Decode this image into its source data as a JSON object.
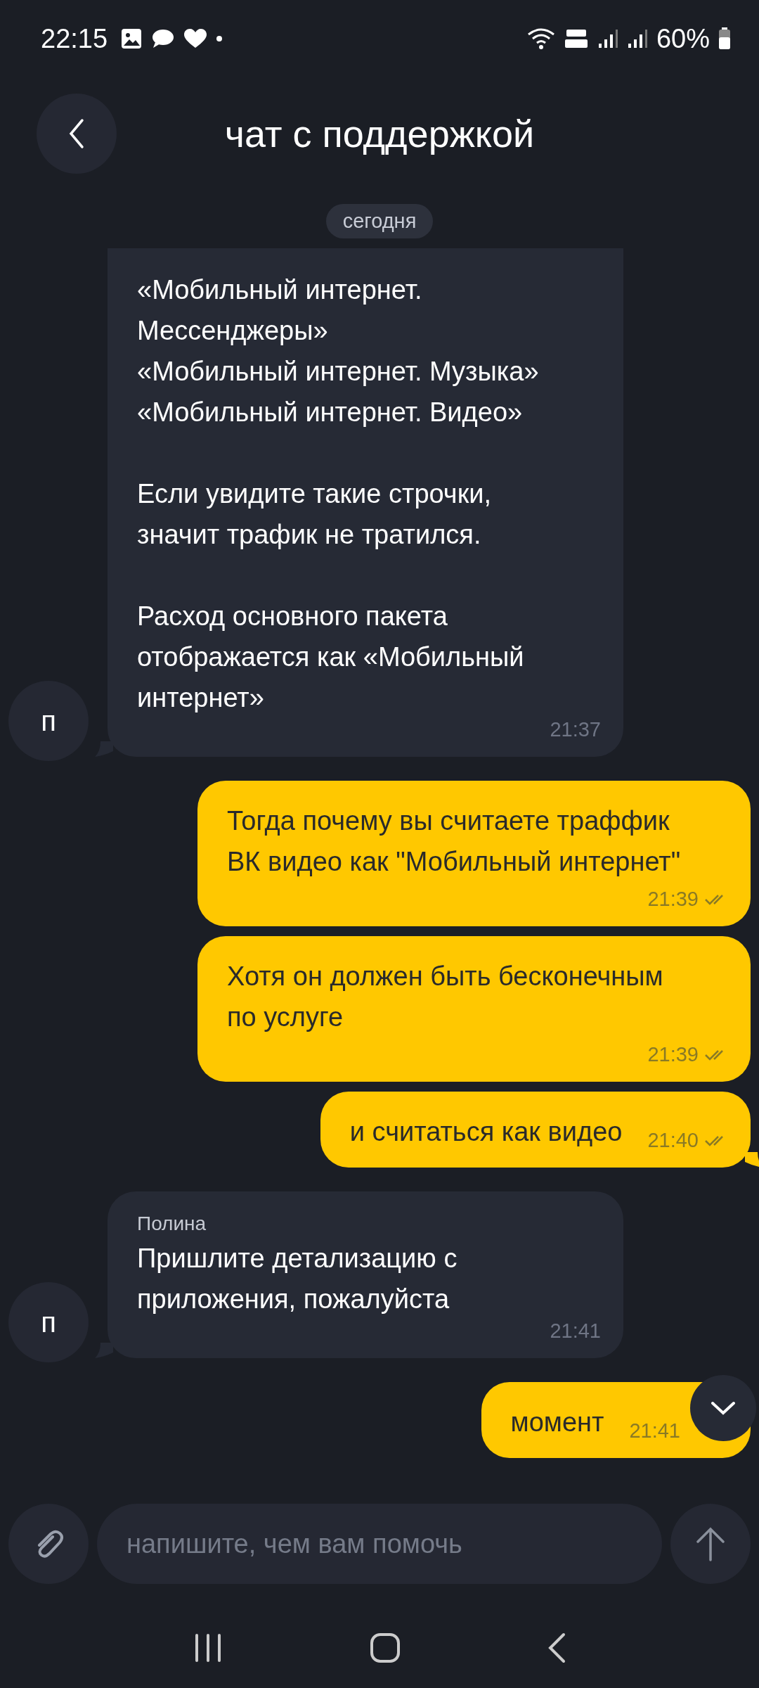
{
  "status_bar": {
    "time": "22:15",
    "battery": "60%"
  },
  "header": {
    "title": "чат с поддержкой"
  },
  "date_chip": "сегодня",
  "messages": [
    {
      "kind": "incoming",
      "avatar": "п",
      "text": "«Мобильный интернет.\nМессенджеры»\n«Мобильный интернет. Музыка»\n«Мобильный интернет. Видео»\n\nЕсли увидите такие строчки,\nзначит трафик не тратился.\n\nРасход основного пакета\nотображается как «Мобильный\nинтернет»",
      "time": "21:37",
      "tail": true
    },
    {
      "kind": "outgoing",
      "text": "Тогда почему вы считаете траффик\nВК видео как \"Мобильный интернет\"",
      "time": "21:39",
      "read": true,
      "tail": false
    },
    {
      "kind": "outgoing",
      "text": "Хотя он должен быть бесконечным\nпо услуге",
      "time": "21:39",
      "read": true,
      "tail": false
    },
    {
      "kind": "outgoing",
      "text": "и считаться как видео",
      "time": "21:40",
      "read": true,
      "tail": true
    },
    {
      "kind": "incoming",
      "avatar": "п",
      "sender": "Полина",
      "text": "Пришлите детализацию с\nприложения, пожалуйста",
      "time": "21:41",
      "tail": true
    },
    {
      "kind": "outgoing",
      "text": "момент",
      "time": "21:41",
      "tail": false
    }
  ],
  "composer": {
    "placeholder": "напишите, чем вам помочь"
  }
}
